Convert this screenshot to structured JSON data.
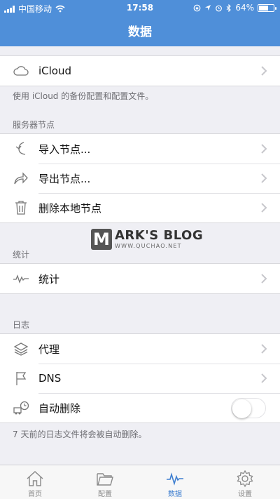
{
  "status_bar": {
    "carrier": "中国移动",
    "time": "17:58",
    "battery": "64%",
    "battery_level": 0.64
  },
  "nav": {
    "title": "数据"
  },
  "icloud_section": {
    "items": [
      {
        "label": "iCloud",
        "icon": "cloud-icon"
      }
    ],
    "footer": "使用 iCloud 的备份配置和配置文件。"
  },
  "server_section": {
    "header": "服务器节点",
    "items": [
      {
        "label": "导入节点...",
        "icon": "import-icon"
      },
      {
        "label": "导出节点...",
        "icon": "export-icon"
      },
      {
        "label": "删除本地节点",
        "icon": "trash-icon"
      }
    ]
  },
  "stats_section": {
    "header": "统计",
    "items": [
      {
        "label": "统计",
        "icon": "pulse-icon"
      }
    ]
  },
  "log_section": {
    "header": "日志",
    "items": [
      {
        "label": "代理",
        "icon": "layers-icon"
      },
      {
        "label": "DNS",
        "icon": "flag-icon"
      },
      {
        "label": "自动删除",
        "icon": "auto-delete-icon",
        "toggle": false
      }
    ],
    "footer": "7 天前的日志文件将会被自动删除。"
  },
  "watermark": {
    "logo": "M",
    "text": "ARK'S BLOG",
    "url": "WWW.QUCHAO.NET"
  },
  "tabbar": {
    "items": [
      {
        "label": "首页",
        "icon": "home-icon",
        "active": false
      },
      {
        "label": "配置",
        "icon": "folder-icon",
        "active": false
      },
      {
        "label": "数据",
        "icon": "pulse-icon",
        "active": true
      },
      {
        "label": "设置",
        "icon": "gear-icon",
        "active": false
      }
    ]
  },
  "colors": {
    "accent": "#4f8fd9",
    "active_tab": "#3f7fd0",
    "background": "#efeff4"
  }
}
